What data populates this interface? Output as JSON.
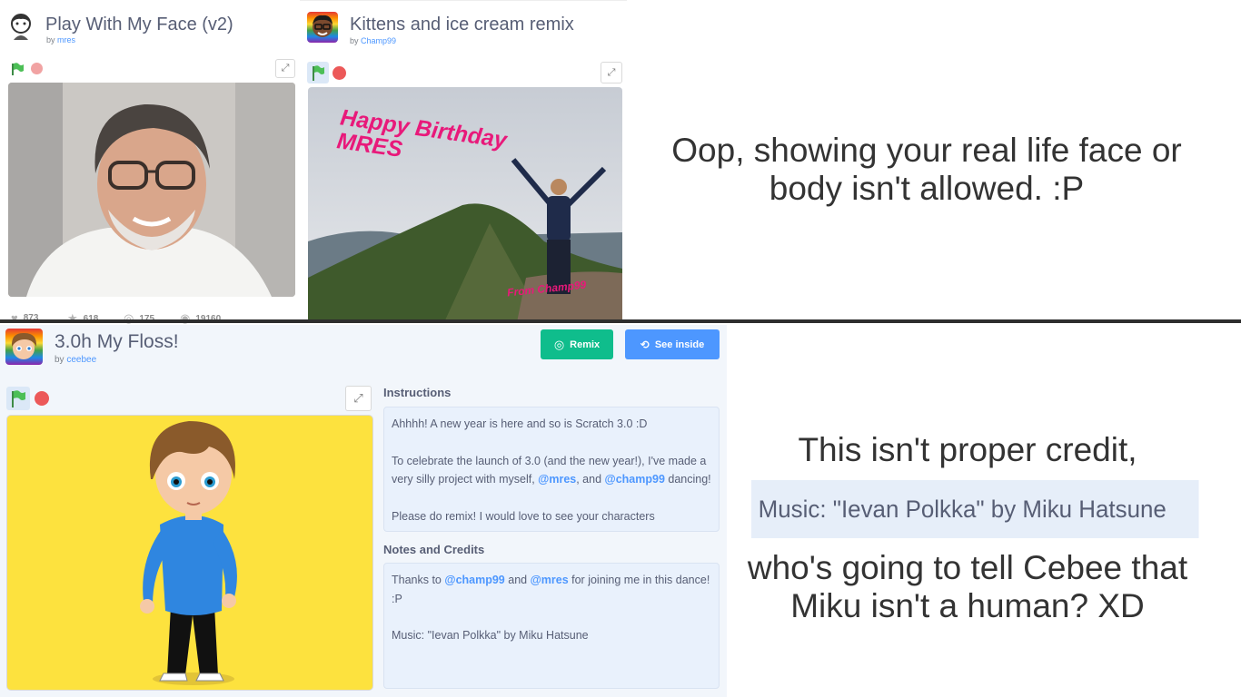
{
  "top_projects": {
    "left": {
      "title": "Play With My Face (v2)",
      "by_prefix": "by",
      "author": "mres",
      "stats": {
        "loves": "873",
        "favorites": "618",
        "remixes": "175",
        "views": "19160"
      }
    },
    "right": {
      "title": "Kittens and ice cream remix",
      "by_prefix": "by",
      "author": "Champ99",
      "art_text_1": "Happy Birthday",
      "art_text_2": "MRES",
      "art_signature": "From Champ99"
    }
  },
  "caption_top": "Oop, showing your real life face or body isn't allowed. :P",
  "main_project": {
    "title": "3.0h My Floss!",
    "by_prefix": "by",
    "author": "ceebee",
    "remix_label": "Remix",
    "see_inside_label": "See inside",
    "instructions_title": "Instructions",
    "instructions": {
      "p1": "Ahhhh! A new year is here and so is Scratch 3.0 :D",
      "p2_a": "To celebrate the launch of 3.0 (and the new year!), I've made a very silly project with myself, ",
      "p2_mention1": "@mres",
      "p2_b": ", and ",
      "p2_mention2": "@champ99",
      "p2_c": " dancing!",
      "p3": "Please do remix! I would love to see your characters"
    },
    "notes_title": "Notes and Credits",
    "notes": {
      "a": "Thanks to ",
      "mention1": "@champ99",
      "b": " and ",
      "mention2": "@mres",
      "c": " for joining me in this dance! :P",
      "music": "Music: \"Ievan Polkka\" by Miku Hatsune"
    }
  },
  "caption_bottom_1": "This isn't proper credit,",
  "highlight_quote": "Music: \"Ievan Polkka\" by Miku Hatsune",
  "caption_bottom_2": "who's going to tell Cebee that Miku isn't a human? XD",
  "colors": {
    "flag_green": "#4cbf56",
    "stop_red": "#ec5959",
    "remix_green": "#0fbd8c",
    "see_inside_blue": "#4d97ff",
    "stage_yellow": "#fde23e",
    "highlight_bg": "#e6eef9"
  }
}
